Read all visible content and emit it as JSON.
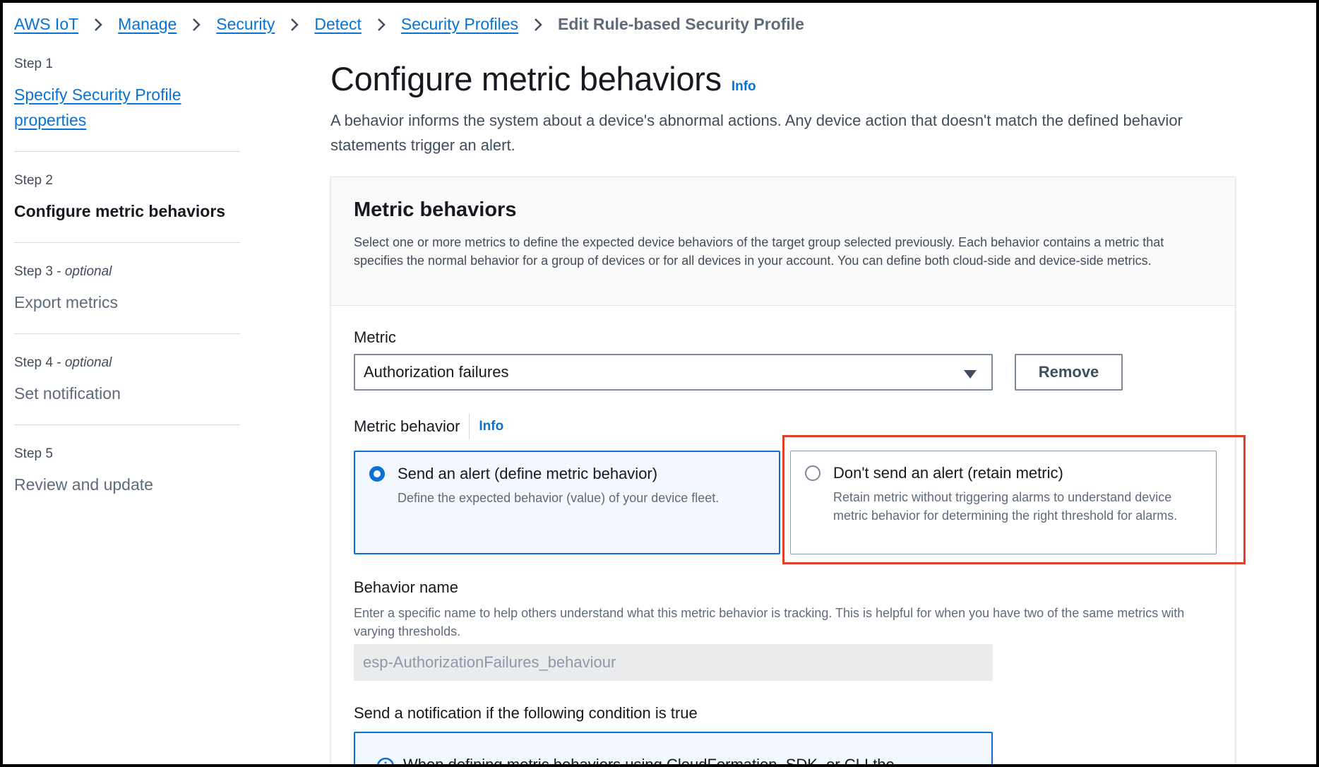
{
  "breadcrumb": {
    "items": [
      "AWS IoT",
      "Manage",
      "Security",
      "Detect",
      "Security Profiles"
    ],
    "current": "Edit Rule-based Security Profile"
  },
  "sidebar": {
    "steps": [
      {
        "label": "Step 1",
        "optional": "",
        "title": "Specify Security Profile properties",
        "state": "link"
      },
      {
        "label": "Step 2",
        "optional": "",
        "title": "Configure metric behaviors",
        "state": "active"
      },
      {
        "label": "Step 3",
        "optional": "optional",
        "title": "Export metrics",
        "state": "disabled"
      },
      {
        "label": "Step 4",
        "optional": "optional",
        "title": "Set notification",
        "state": "disabled"
      },
      {
        "label": "Step 5",
        "optional": "",
        "title": "Review and update",
        "state": "disabled"
      }
    ]
  },
  "page": {
    "title": "Configure metric behaviors",
    "info": "Info",
    "description": "A behavior informs the system about a device's abnormal actions. Any device action that doesn't match the defined behavior statements trigger an alert."
  },
  "container": {
    "title": "Metric behaviors",
    "description": "Select one or more metrics to define the expected device behaviors of the target group selected previously. Each behavior contains a metric that specifies the normal behavior for a group of devices or for all devices in your account. You can define both cloud-side and device-side metrics."
  },
  "metric": {
    "label": "Metric",
    "selected": "Authorization failures",
    "remove_label": "Remove"
  },
  "metric_behavior": {
    "label": "Metric behavior",
    "info": "Info",
    "options": [
      {
        "title": "Send an alert (define metric behavior)",
        "description": "Define the expected behavior (value) of your device fleet.",
        "checked": true
      },
      {
        "title": "Don't send an alert (retain metric)",
        "description": "Retain metric without triggering alarms to understand device metric behavior for determining the right threshold for alarms.",
        "checked": false
      }
    ]
  },
  "behavior_name": {
    "label": "Behavior name",
    "description": "Enter a specific name to help others understand what this metric behavior is tracking. This is helpful for when you have two of the same metrics with varying thresholds.",
    "value": "esp-AuthorizationFailures_behaviour"
  },
  "condition": {
    "label": "Send a notification if the following condition is true",
    "alert_text": "When defining metric behaviors using CloudFormation, SDK, or CLI the"
  },
  "colors": {
    "link": "#0972d3",
    "highlight": "#e0402a",
    "selected_bg": "#f2f8fd"
  }
}
